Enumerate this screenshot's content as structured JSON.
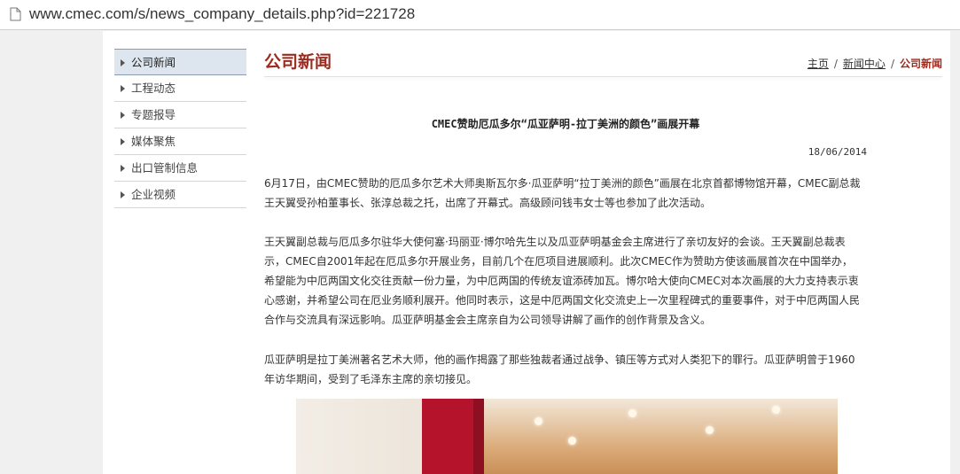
{
  "browser": {
    "url": "www.cmec.com/s/news_company_details.php?id=221728",
    "page_icon": "page-icon"
  },
  "sidebar": {
    "items": [
      {
        "label": "公司新闻",
        "active": true
      },
      {
        "label": "工程动态",
        "active": false
      },
      {
        "label": "专题报导",
        "active": false
      },
      {
        "label": "媒体聚焦",
        "active": false
      },
      {
        "label": "出口管制信息",
        "active": false
      },
      {
        "label": "企业视频",
        "active": false
      }
    ]
  },
  "header": {
    "title": "公司新闻",
    "breadcrumb": {
      "home": "主页",
      "section": "新闻中心",
      "current": "公司新闻",
      "separator": "/"
    }
  },
  "article": {
    "title": "CMEC赞助厄瓜多尔“瓜亚萨明-拉丁美洲的颜色”画展开幕",
    "date": "18/06/2014",
    "paragraphs": [
      "6月17日，由CMEC赞助的厄瓜多尔艺术大师奥斯瓦尔多·瓜亚萨明“拉丁美洲的颜色”画展在北京首都博物馆开幕，CMEC副总裁王天翼受孙柏董事长、张淳总裁之托，出席了开幕式。高级顾问钱韦女士等也参加了此次活动。",
      "王天翼副总裁与厄瓜多尔驻华大使何塞·玛丽亚·博尔哈先生以及瓜亚萨明基金会主席进行了亲切友好的会谈。王天翼副总裁表示，CMEC自2001年起在厄瓜多尔开展业务，目前几个在厄项目进展顺利。此次CMEC作为赞助方使该画展首次在中国举办，希望能为中厄两国文化交往贡献一份力量，为中厄两国的传统友谊添砖加瓦。博尔哈大使向CMEC对本次画展的大力支持表示衷心感谢，并希望公司在厄业务顺利展开。他同时表示，这是中厄两国文化交流史上一次里程碑式的重要事件，对于中厄两国人民合作与交流具有深远影响。瓜亚萨明基金会主席亲自为公司领导讲解了画作的创作背景及含义。",
      "瓜亚萨明是拉丁美洲著名艺术大师，他的画作揭露了那些独裁者通过战争、镇压等方式对人类犯下的罪行。瓜亚萨明曾于1960年访华期间，受到了毛泽东主席的亲切接见。"
    ]
  },
  "colors": {
    "accent": "#9b2b1f",
    "sidebar_active_bg": "#dde5ee",
    "photo_red": "#b5132c"
  }
}
